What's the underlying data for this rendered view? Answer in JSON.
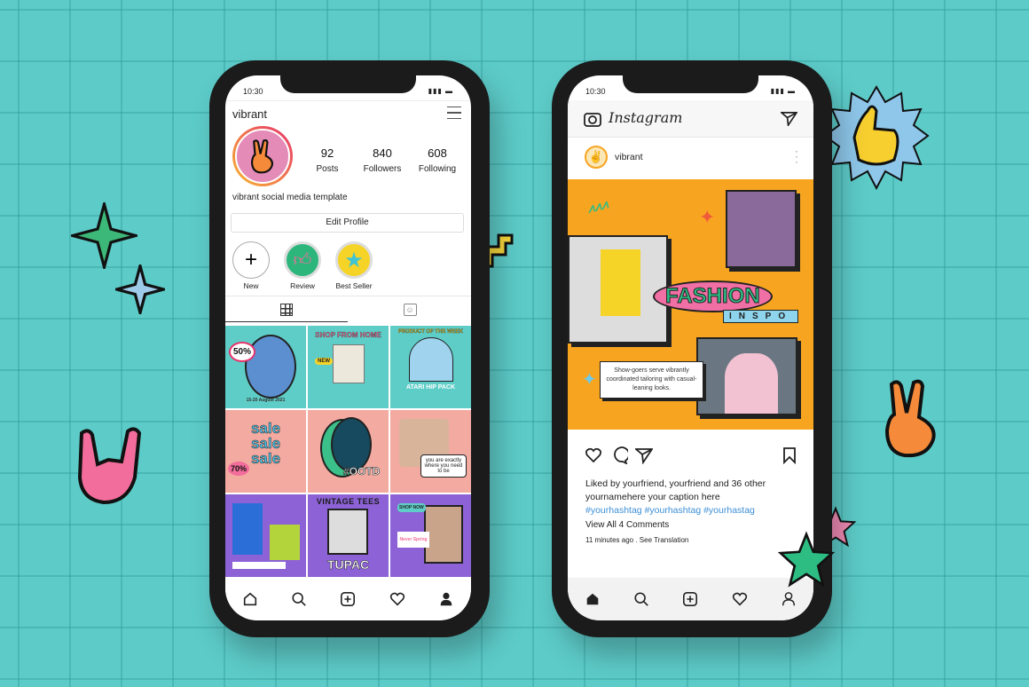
{
  "colors": {
    "background": "#5dcbc8",
    "accent_orange": "#f7a521",
    "hashtag": "#3d8fd6",
    "pink": "#f3aaa0",
    "purple": "#8c62d6",
    "teal": "#5fcdc7"
  },
  "profile_phone": {
    "status_time": "10:30",
    "username": "vibrant",
    "stats": [
      {
        "value": "92",
        "label": "Posts"
      },
      {
        "value": "840",
        "label": "Followers"
      },
      {
        "value": "608",
        "label": "Following"
      }
    ],
    "bio": "vibrant social media template",
    "edit_profile": "Edit Profile",
    "highlights": [
      {
        "label": "New",
        "icon": "plus-icon"
      },
      {
        "label": "Review",
        "icon": "thumbs-up-icon"
      },
      {
        "label": "Best Seller",
        "icon": "star-icon"
      }
    ],
    "tabs": [
      "grid-icon",
      "tagged-icon"
    ],
    "grid": [
      {
        "text": "50%",
        "sub": "15-20 August 2021",
        "bg": "#5fcdc7"
      },
      {
        "text": "SHOP FROM HOME",
        "sub": "NEW",
        "bg": "#5fcdc7"
      },
      {
        "text": "PRODUCT OF THE WEEK",
        "sub": "ATARI HIP PACK",
        "bg": "#5fcdc7"
      },
      {
        "text": "sale sale sale",
        "sub": "70%",
        "bg": "#f3aaa0"
      },
      {
        "text": "#OOTD",
        "sub": "",
        "bg": "#f3aaa0"
      },
      {
        "text": "you are exactly where you need to be",
        "sub": "",
        "bg": "#f3aaa0"
      },
      {
        "text": "",
        "sub": "",
        "bg": "#8c62d6"
      },
      {
        "text": "TUPAC",
        "sub": "VINTAGE TEES",
        "bg": "#8c62d6"
      },
      {
        "text": "SHOP NOW",
        "sub": "Never Spring",
        "bg": "#8c62d6"
      }
    ],
    "nav": [
      "home-icon",
      "search-icon",
      "add-icon",
      "heart-icon",
      "profile-icon"
    ]
  },
  "post_phone": {
    "status_time": "10:30",
    "app_name": "Instagram",
    "post_user": "vibrant",
    "post_image": {
      "title": "FASHION",
      "subtitle": "INSPO",
      "caption_box": "Show-goers serve vibrantly coordinated tailoring with casual-leaning looks."
    },
    "likes_line": "Liked by yourfriend, yourfriend and 36 other",
    "caption": "yournamehere your caption here",
    "hashtags": "#yourhashtag #yourhashtag #yourhastag",
    "comments": "View All 4 Comments",
    "time": "11 minutes ago . See Translation",
    "nav": [
      "home-icon",
      "search-icon",
      "add-icon",
      "heart-icon",
      "profile-icon"
    ]
  }
}
